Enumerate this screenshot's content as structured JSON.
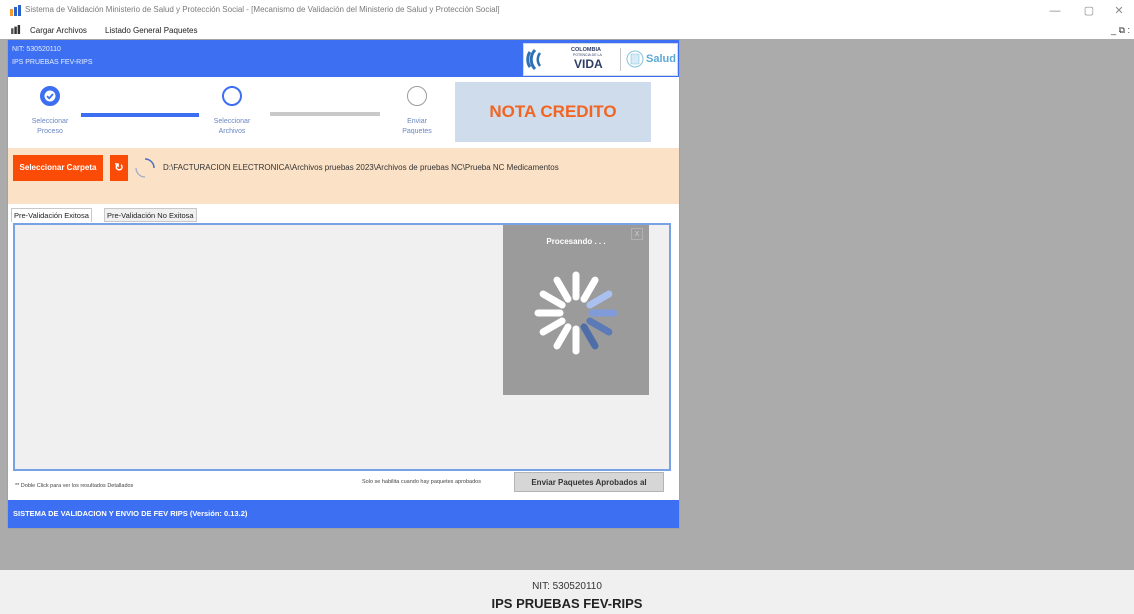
{
  "window": {
    "title": "Sistema de Validación Ministerio de Salud y Protección Social - [Mecanismo de Validación del Ministerio de Salud y Protección Social]",
    "controls": {
      "minimize": "—",
      "maximize": "▢",
      "close": "✕"
    }
  },
  "menu": {
    "items": [
      "Cargar Archivos",
      "Listado General Paquetes"
    ],
    "mdi_controls": "_ ⧉ :"
  },
  "header": {
    "nit": "NIT: 530520110",
    "ips": "IPS PRUEBAS FEV-RIPS",
    "logo": {
      "colombia": "COLOMBIA",
      "potencia": "POTENCIA DE LA",
      "vida": "VIDA",
      "salud": "Salud"
    }
  },
  "steps": [
    {
      "label_1": "Seleccionar",
      "label_2": "Proceso",
      "state": "done"
    },
    {
      "label_1": "Seleccionar",
      "label_2": "Archivos",
      "state": "current"
    },
    {
      "label_1": "Enviar",
      "label_2": "Paquetes",
      "state": "pending"
    }
  ],
  "nota_credito": "NOTA CREDITO",
  "toolbar": {
    "select_folder": "Seleccionar Carpeta",
    "refresh_glyph": "↻",
    "path": "D:\\FACTURACION ELECTRONICA\\Archivos pruebas 2023\\Archivos de pruebas NC\\Prueba NC Medicamentos"
  },
  "tabs": [
    "Pre-Validación Exitosa",
    "Pre-Validación No Exitosa"
  ],
  "loading": {
    "text": "Procesando . . .",
    "close": "X"
  },
  "footer": {
    "note": "** Doble Click para ver los resultados Detallados",
    "solo": "Solo se habilita cuando hay paquetes aprobados",
    "send_button": "Enviar Paquetes Aprobados al"
  },
  "status": "SISTEMA DE VALIDACION Y ENVIO DE FEV RIPS  (Versión: 0.13.2)",
  "bottom": {
    "nit": "NIT: 530520110",
    "ips": "IPS PRUEBAS FEV-RIPS"
  },
  "colors": {
    "brand_blue": "#3c6ff2",
    "accent_orange": "#fa4b07",
    "nota_orange": "#f26422",
    "toolbar_bg": "#fbe1c6"
  }
}
